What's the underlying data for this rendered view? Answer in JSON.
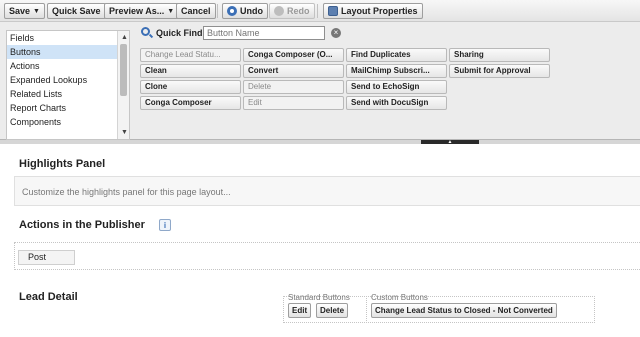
{
  "toolbar": {
    "save_label": "Save",
    "quick_save_label": "Quick Save",
    "preview_label": "Preview As...",
    "cancel_label": "Cancel",
    "undo_label": "Undo",
    "redo_label": "Redo",
    "layout_properties_label": "Layout Properties"
  },
  "palette": {
    "categories": [
      "Fields",
      "Buttons",
      "Actions",
      "Expanded Lookups",
      "Related Lists",
      "Report Charts",
      "Components"
    ],
    "selected_category": "Buttons",
    "quick_find": {
      "label": "Quick Find",
      "placeholder": "Button Name"
    },
    "buttons": [
      {
        "label": "Change Lead Statu...",
        "used": true
      },
      {
        "label": "Conga Composer (O...",
        "used": false
      },
      {
        "label": "Find Duplicates",
        "used": false
      },
      {
        "label": "Sharing",
        "used": false
      },
      {
        "label": "Clean",
        "used": false
      },
      {
        "label": "Convert",
        "used": false
      },
      {
        "label": "MailChimp Subscri...",
        "used": false
      },
      {
        "label": "Submit for Approval",
        "used": false
      },
      {
        "label": "Clone",
        "used": false
      },
      {
        "label": "Delete",
        "used": true
      },
      {
        "label": "Send to EchoSign",
        "used": false
      },
      {
        "label": "Conga Composer",
        "used": false
      },
      {
        "label": "Edit",
        "used": true
      },
      {
        "label": "Send with DocuSign",
        "used": false
      }
    ]
  },
  "layout": {
    "highlights_title": "Highlights Panel",
    "highlights_hint": "Customize the highlights panel for this page layout...",
    "publisher_title": "Actions in the Publisher",
    "publisher_info": "i",
    "post_label": "Post",
    "lead_detail_title": "Lead Detail",
    "standard_buttons_label": "Standard Buttons",
    "custom_buttons_label": "Custom Buttons",
    "edit_label": "Edit",
    "delete_label": "Delete",
    "custom_button_label": "Change Lead Status to Closed - Not Converted"
  }
}
